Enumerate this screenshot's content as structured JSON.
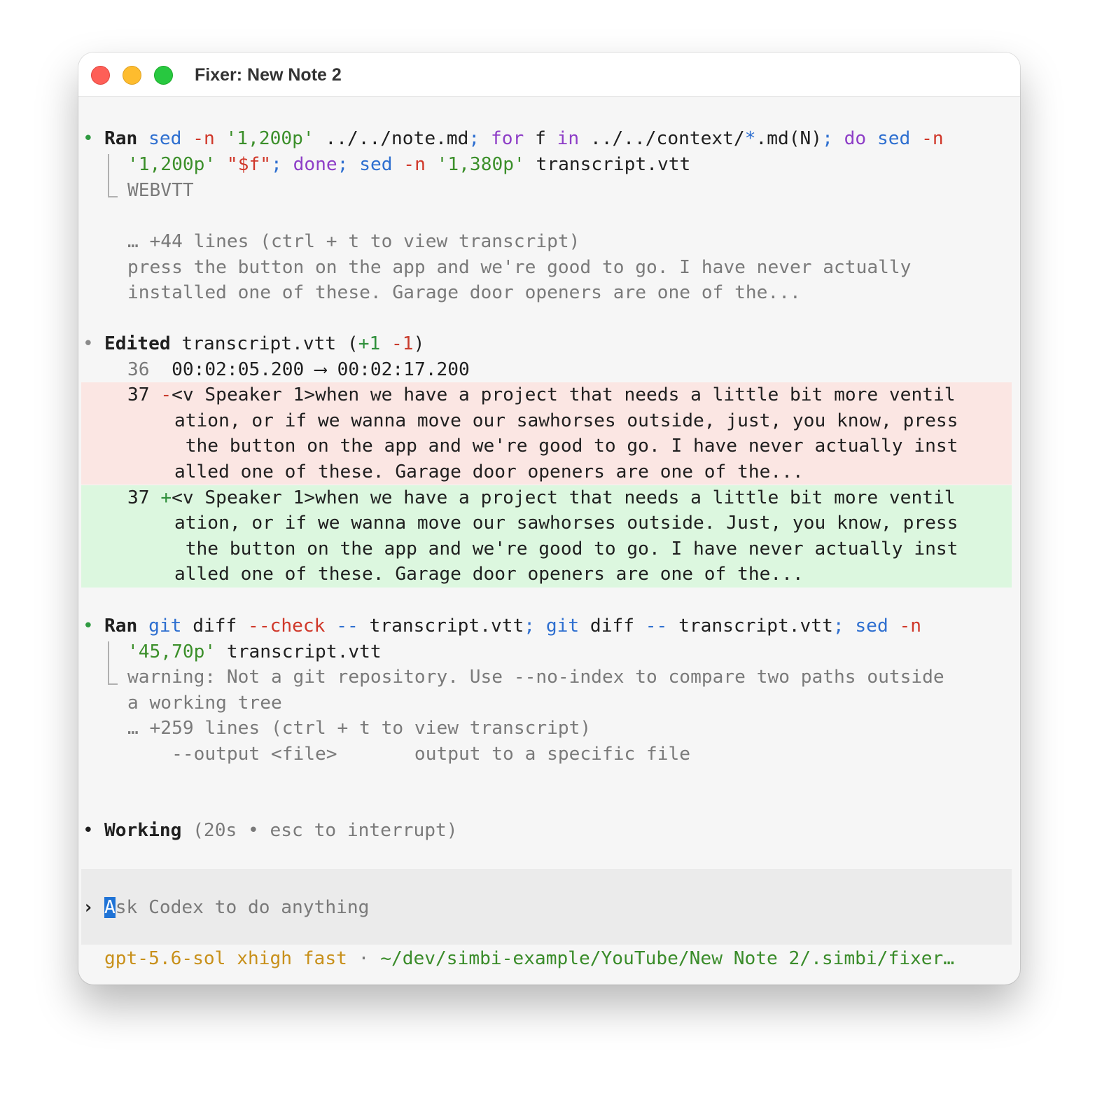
{
  "window": {
    "title": "Fixer: New Note 2"
  },
  "ran1": {
    "bullet": "•",
    "verb": "Ran",
    "l1": [
      "sed",
      "-n",
      "'1,200p'",
      "../../note.md",
      ";",
      "for",
      "f",
      "in",
      "../../context/",
      "*",
      ".md(N)",
      ";",
      "do",
      "sed",
      "-n"
    ],
    "l2": [
      "'1,200p'",
      "\"$f\"",
      ";",
      "done",
      ";",
      "sed",
      "-n",
      "'1,380p'",
      "transcript.vtt"
    ],
    "output": [
      "WEBVTT",
      "",
      "… +44 lines (ctrl + t to view transcript)",
      "press the button on the app and we're good to go. I have never actually",
      "installed one of these. Garage door openers are one of the..."
    ]
  },
  "edited": {
    "bullet": "•",
    "verb": "Edited",
    "file": "transcript.vtt",
    "open": "(",
    "plus": "+1",
    "minus": "-1",
    "close": ")",
    "ctx_num": "36",
    "ctx_text": "00:02:05.200 ⟶ 00:02:17.200",
    "del_num": "37",
    "del_sign": "-",
    "del_lines": [
      "<v Speaker 1>when we have a project that needs a little bit more ventil",
      "ation, or if we wanna move our sawhorses outside, just, you know, press",
      " the button on the app and we're good to go. I have never actually inst",
      "alled one of these. Garage door openers are one of the..."
    ],
    "add_num": "37",
    "add_sign": "+",
    "add_lines": [
      "<v Speaker 1>when we have a project that needs a little bit more ventil",
      "ation, or if we wanna move our sawhorses outside. Just, you know, press",
      " the button on the app and we're good to go. I have never actually inst",
      "alled one of these. Garage door openers are one of the..."
    ]
  },
  "ran2": {
    "bullet": "•",
    "verb": "Ran",
    "l1": [
      "git",
      "diff",
      "--check",
      "--",
      "transcript.vtt",
      ";",
      "git",
      "diff",
      "--",
      "transcript.vtt",
      ";",
      "sed",
      "-n"
    ],
    "l2": [
      "'45,70p'",
      "transcript.vtt"
    ],
    "output": [
      "warning: Not a git repository. Use --no-index to compare two paths outside",
      "a working tree",
      "… +259 lines (ctrl + t to view transcript)",
      "    --output <file>       output to a specific file"
    ]
  },
  "working": {
    "bullet": "•",
    "label": "Working",
    "status": "(20s • esc to interrupt)"
  },
  "input": {
    "prompt": "›",
    "cursor_char": "A",
    "placeholder_rest": "sk Codex to do anything"
  },
  "footer": {
    "model": "gpt-5.6-sol xhigh fast",
    "sep": "·",
    "path": "~/dev/simbi-example/YouTube/New Note 2/.simbi/fixer…"
  },
  "colors": {
    "command": "#2e6fd0",
    "keyword": "#8e3ec7",
    "flag": "#d0382a",
    "string": "#3b8f2a",
    "deleted_bg": "#fbe6e3",
    "added_bg": "#dcf7df",
    "cursor": "#1f73d6"
  }
}
